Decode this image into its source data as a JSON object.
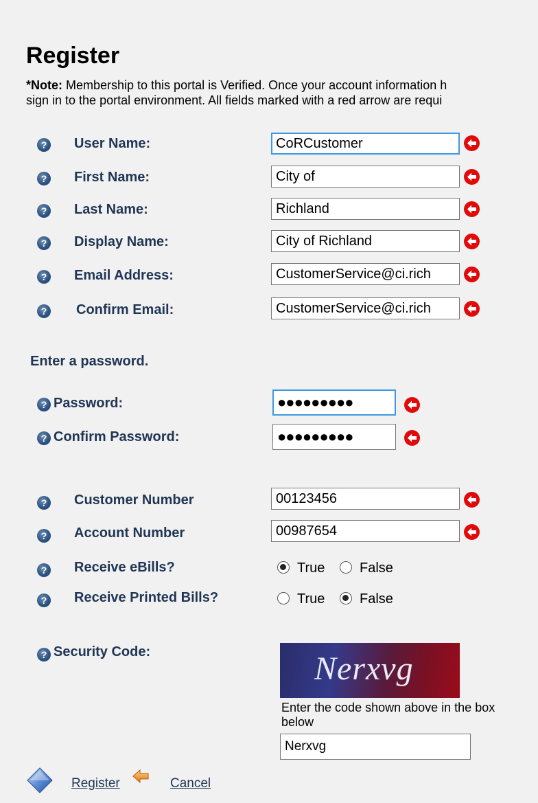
{
  "header": {
    "title": "Register",
    "note_bold": "*Note:",
    "note_line1": " Membership to this portal is Verified. Once your account information h",
    "note_line2": "sign in to the portal environment. All fields marked with a red arrow are requi"
  },
  "fields": [
    {
      "label": "User Name:",
      "value": "CoRCustomer"
    },
    {
      "label": "First Name:",
      "value": "City of"
    },
    {
      "label": "Last Name:",
      "value": "Richland"
    },
    {
      "label": "Display Name:",
      "value": "City of Richland"
    },
    {
      "label": "Email Address:",
      "value": "CustomerService@ci.rich"
    },
    {
      "label": "Confirm Email:",
      "value": "CustomerService@ci.rich"
    }
  ],
  "password_section": {
    "heading": "Enter a password.",
    "password_label": "Password:",
    "password_value": "●●●●●●●●●",
    "confirm_label": "Confirm Password:",
    "confirm_value": "●●●●●●●●●"
  },
  "account": {
    "customer_label": "Customer Number",
    "customer_value": "00123456",
    "account_label": "Account Number",
    "account_value": "00987654",
    "ebills_label": "Receive eBills?",
    "printed_label": "Receive Printed Bills?",
    "true_label": "True",
    "false_label": "False",
    "ebills_selected": "True",
    "printed_selected": "False"
  },
  "security": {
    "label": "Security Code:",
    "captcha_text": "Nerxvg",
    "instruction": "Enter the code shown above in the box below",
    "value": "Nerxvg"
  },
  "actions": {
    "register_label": "Register",
    "cancel_label": "Cancel"
  },
  "icons": {
    "help": "help-icon",
    "required": "required-arrow-icon",
    "register": "register-diamond-icon",
    "back": "back-arrow-icon"
  },
  "colors": {
    "label": "#1f3554",
    "required": "#e10a0a",
    "focus": "#3d99e0"
  }
}
